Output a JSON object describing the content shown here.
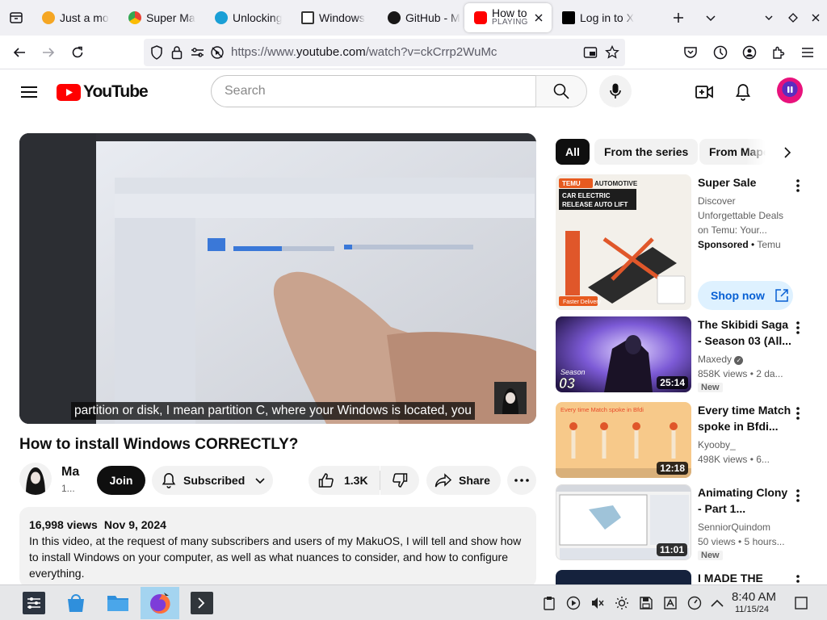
{
  "browser": {
    "tabs": [
      {
        "label": "Just a mo",
        "favicon_color": "#f5a623"
      },
      {
        "label": "Super Ma",
        "favicon_color": "#4285f4"
      },
      {
        "label": "Unlocking",
        "favicon_color": "#1a9fd6"
      },
      {
        "label": "Windows",
        "favicon_color": "#333333"
      },
      {
        "label": "GitHub - M",
        "favicon_color": "#181717"
      },
      {
        "label": "How to",
        "sublabel": "PLAYING",
        "favicon_color": "#ff0000",
        "active": true
      },
      {
        "label": "Log in to X",
        "favicon_color": "#000000"
      }
    ],
    "url": {
      "scheme": "https://www.",
      "host": "youtube.com",
      "path": "/watch?v=ckCrrp2WuMc"
    }
  },
  "youtube": {
    "logo_text": "YouTube",
    "search_placeholder": "Search",
    "video": {
      "caption": "partition or disk, I mean partition C, where your Windows is located, you",
      "title": "How to install Windows CORRECTLY?",
      "channel_name": "Ma",
      "channel_subs": "1...",
      "join_label": "Join",
      "subscribed_label": "Subscribed",
      "likes": "1.3K",
      "share_label": "Share",
      "views": "16,998 views",
      "date": "Nov 9, 2024",
      "description": "In this video, at the request of many subscribers and users of my MakuOS, I will tell and show how to install Windows on your computer, as well as what nuances to consider, and how to configure everything."
    },
    "chips": [
      "All",
      "From the series",
      "From Mape"
    ],
    "recommendations": [
      {
        "title": "Super Sale",
        "meta_lines": [
          "Discover",
          "Unforgettable Deals",
          "on Temu: Your..."
        ],
        "sponsored_label": "Sponsored",
        "advertiser": "Temu",
        "cta": "Shop now",
        "thumb_text": [
          "TEMU",
          "AUTOMOTIVE",
          "CAR ELECTRIC",
          "RELEASE AUTO LIFT",
          "Faster Delivery"
        ]
      },
      {
        "title": "The Skibidi Saga - Season 03 (All...",
        "channel": "Maxedy",
        "stats": "858K views • 2 da...",
        "badge": "New",
        "duration": "25:14",
        "thumb_text": [
          "Season",
          "03"
        ]
      },
      {
        "title": "Every time Match spoke in Bfdi...",
        "channel": "Kyooby_",
        "stats": "498K views • 6...",
        "duration": "12:18",
        "thumb_text": [
          "Every time Match spoke in Bfdi"
        ]
      },
      {
        "title": "Animating Clony - Part 1...",
        "channel": "SenniorQuindom",
        "stats": "50 views • 5 hours...",
        "badge": "New",
        "duration": "11:01"
      },
      {
        "title": "I MADE THE"
      }
    ]
  },
  "taskbar": {
    "time": "8:40 AM",
    "date": "11/15/24"
  },
  "colors": {
    "yt_red": "#ff0000",
    "accent_blue": "#065fd4",
    "chip_dark": "#0f0f0f"
  }
}
